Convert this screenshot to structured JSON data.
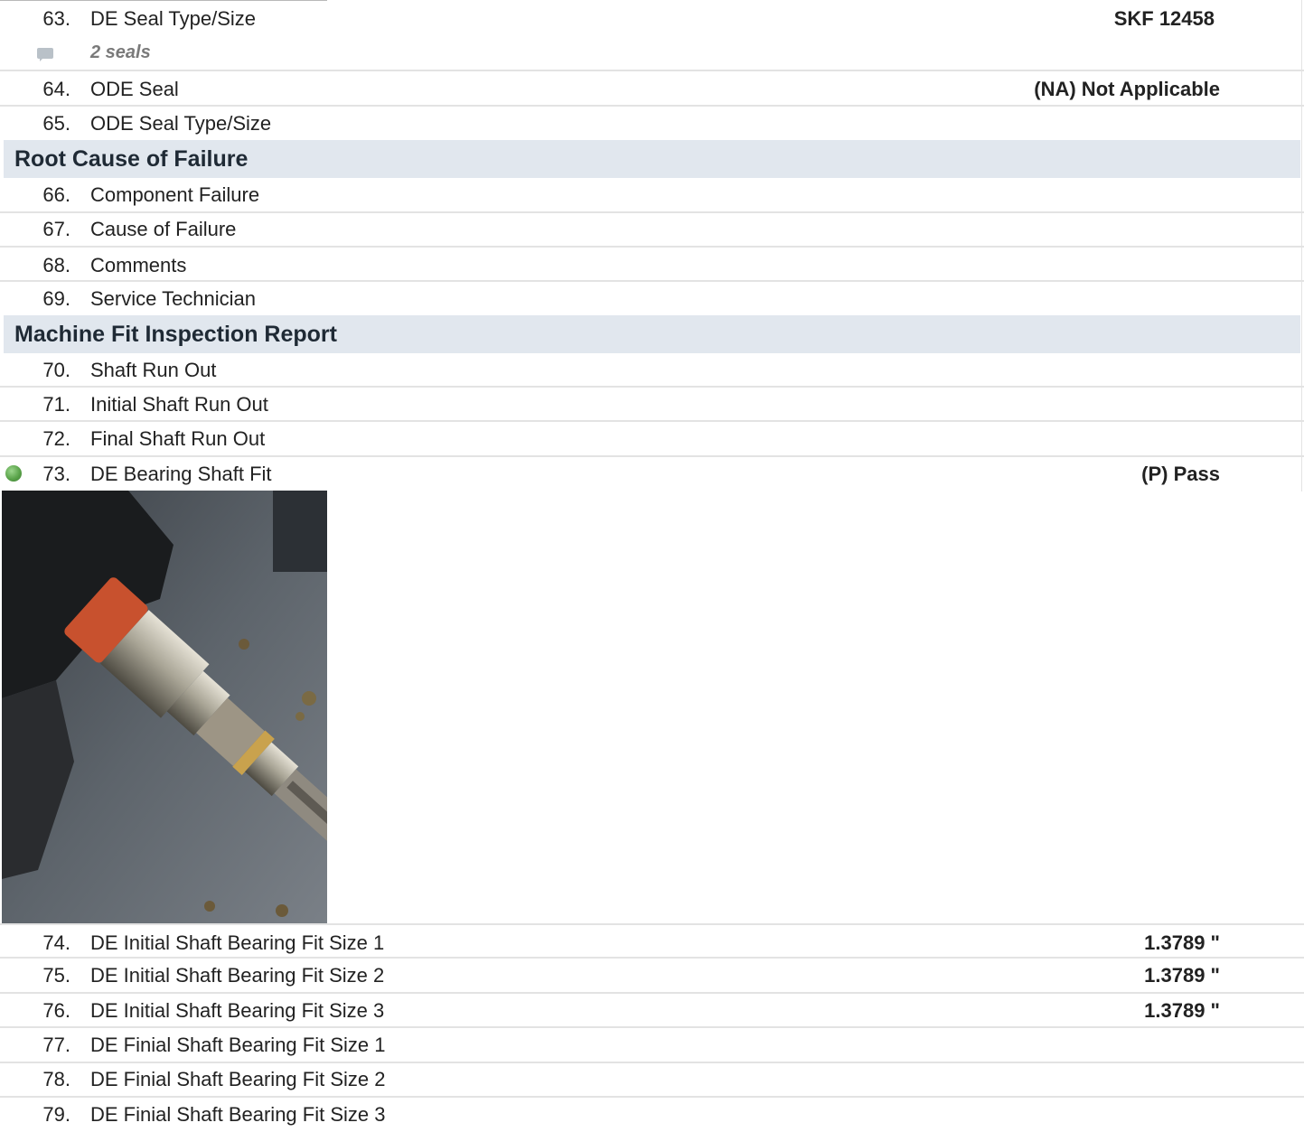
{
  "rows": {
    "r63": {
      "num": "63.",
      "label": "DE Seal Type/Size",
      "value": "SKF 12458"
    },
    "r63_note": "2 seals",
    "r64": {
      "num": "64.",
      "label": "ODE Seal",
      "value": "(NA) Not Applicable"
    },
    "r65": {
      "num": "65.",
      "label": "ODE Seal Type/Size",
      "value": ""
    },
    "r66": {
      "num": "66.",
      "label": "Component Failure",
      "value": ""
    },
    "r67": {
      "num": "67.",
      "label": "Cause of Failure",
      "value": ""
    },
    "r68": {
      "num": "68.",
      "label": "Comments",
      "value": ""
    },
    "r69": {
      "num": "69.",
      "label": "Service Technician",
      "value": ""
    },
    "r70": {
      "num": "70.",
      "label": "Shaft Run Out",
      "value": ""
    },
    "r71": {
      "num": "71.",
      "label": "Initial Shaft Run Out",
      "value": ""
    },
    "r72": {
      "num": "72.",
      "label": "Final Shaft Run Out",
      "value": ""
    },
    "r73": {
      "num": "73.",
      "label": "DE Bearing Shaft Fit",
      "value": "(P) Pass",
      "status_color": "#5aa34a"
    },
    "r74": {
      "num": "74.",
      "label": "DE Initial Shaft Bearing Fit Size 1",
      "value": "1.3789 \""
    },
    "r75": {
      "num": "75.",
      "label": "DE Initial Shaft Bearing Fit Size 2",
      "value": "1.3789 \""
    },
    "r76": {
      "num": "76.",
      "label": "DE Initial Shaft Bearing Fit Size 3",
      "value": "1.3789 \""
    },
    "r77": {
      "num": "77.",
      "label": "DE Finial Shaft Bearing Fit Size 1",
      "value": ""
    },
    "r78": {
      "num": "78.",
      "label": "DE Finial Shaft Bearing Fit Size 2",
      "value": ""
    },
    "r79": {
      "num": "79.",
      "label": "DE Finial Shaft Bearing Fit Size 3",
      "value": ""
    }
  },
  "sections": {
    "root_cause": "Root Cause of Failure",
    "machine_fit": "Machine Fit Inspection Report"
  },
  "colors": {
    "section_bg": "#e1e7ee",
    "pass_indicator": "#5aa34a"
  }
}
